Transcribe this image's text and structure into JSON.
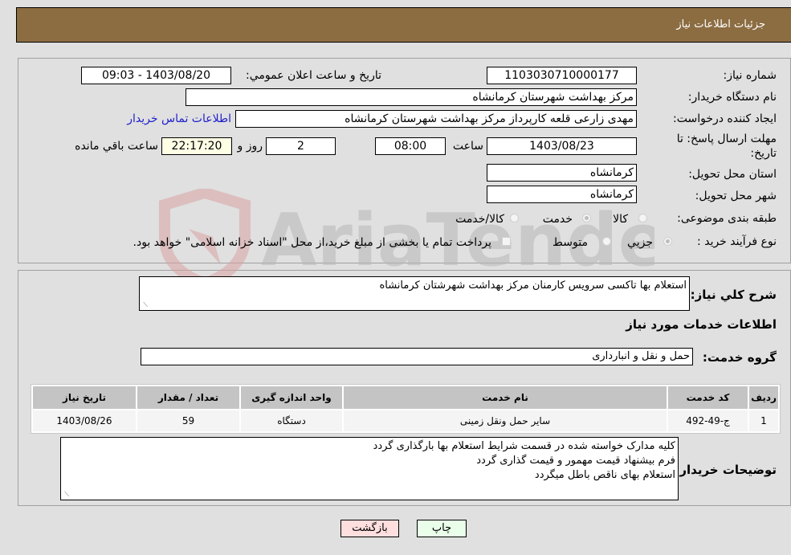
{
  "header": {
    "title": "جزئیات اطلاعات نیاز"
  },
  "form": {
    "need_number": {
      "label": "شماره نیاز:",
      "value": "1103030710000177"
    },
    "announce_datetime": {
      "label": "تاریخ و ساعت اعلان عمومي:",
      "value": "1403/08/20 - 09:03"
    },
    "buyer_org": {
      "label": "نام دستگاه خریدار:",
      "value": "مرکز بهداشت شهرستان کرمانشاه"
    },
    "requester": {
      "label": "ایجاد کننده درخواست:",
      "value": "مهدی  زارعی قلعه کارپرداز مرکز بهداشت شهرستان کرمانشاه"
    },
    "contact_link": "اطلاعات تماس خریدار",
    "deadline": {
      "label_line1": "مهلت ارسال پاسخ: تا",
      "label_line2": "تاریخ:",
      "date": "1403/08/23",
      "time_label": "ساعت",
      "time": "08:00",
      "days": "2",
      "days_label": "روز و",
      "remaining": "22:17:20",
      "remaining_label": "ساعت باقي مانده"
    },
    "delivery_province": {
      "label": "استان محل تحویل:",
      "value": "کرمانشاه"
    },
    "delivery_city": {
      "label": "شهر محل تحویل:",
      "value": "کرمانشاه"
    },
    "category": {
      "label": "طبقه بندی موضوعی:",
      "options": [
        "کالا",
        "خدمت",
        "کالا/خدمت"
      ],
      "selected": "خدمت"
    },
    "purchase_type": {
      "label": "نوع فرآیند خرید :",
      "options": [
        "جزيي",
        "متوسط"
      ],
      "selected": "جزيي",
      "treasury_note": "پرداخت تمام یا بخشی از مبلغ خرید،از محل \"اسناد خزانه اسلامی\" خواهد بود."
    }
  },
  "details": {
    "description_label": "شرح کلي نیاز:",
    "description": "استعلام بها تاکسی سرویس کارمنان مرکز بهداشت شهرشتان کرمانشاه",
    "services_heading": "اطلاعات خدمات مورد نیاز",
    "service_group_label": "گروه خدمت:",
    "service_group": "حمل و نقل و انبارداری",
    "table": {
      "headers": [
        "ردیف",
        "کد خدمت",
        "نام خدمت",
        "واحد اندازه گیری",
        "تعداد / مقدار",
        "تاریخ نیاز"
      ],
      "rows": [
        [
          "1",
          "ج-49-492",
          "سایر حمل ونقل زمینی",
          "دستگاه",
          "59",
          "1403/08/26"
        ]
      ]
    },
    "buyer_notes_label": "توضیحات خریدار:",
    "buyer_notes": [
      "کلیه مدارک خواسته شده در قسمت شرایط استعلام بها بارگذاری گردد",
      "فرم بیشنهاد قیمت مهمور و قیمت گذاری گردد",
      "استعلام  بهای ناقص باطل میگردد"
    ]
  },
  "buttons": {
    "print": "چاپ",
    "back": "بازگشت"
  },
  "watermark": "AriaTender.neT"
}
